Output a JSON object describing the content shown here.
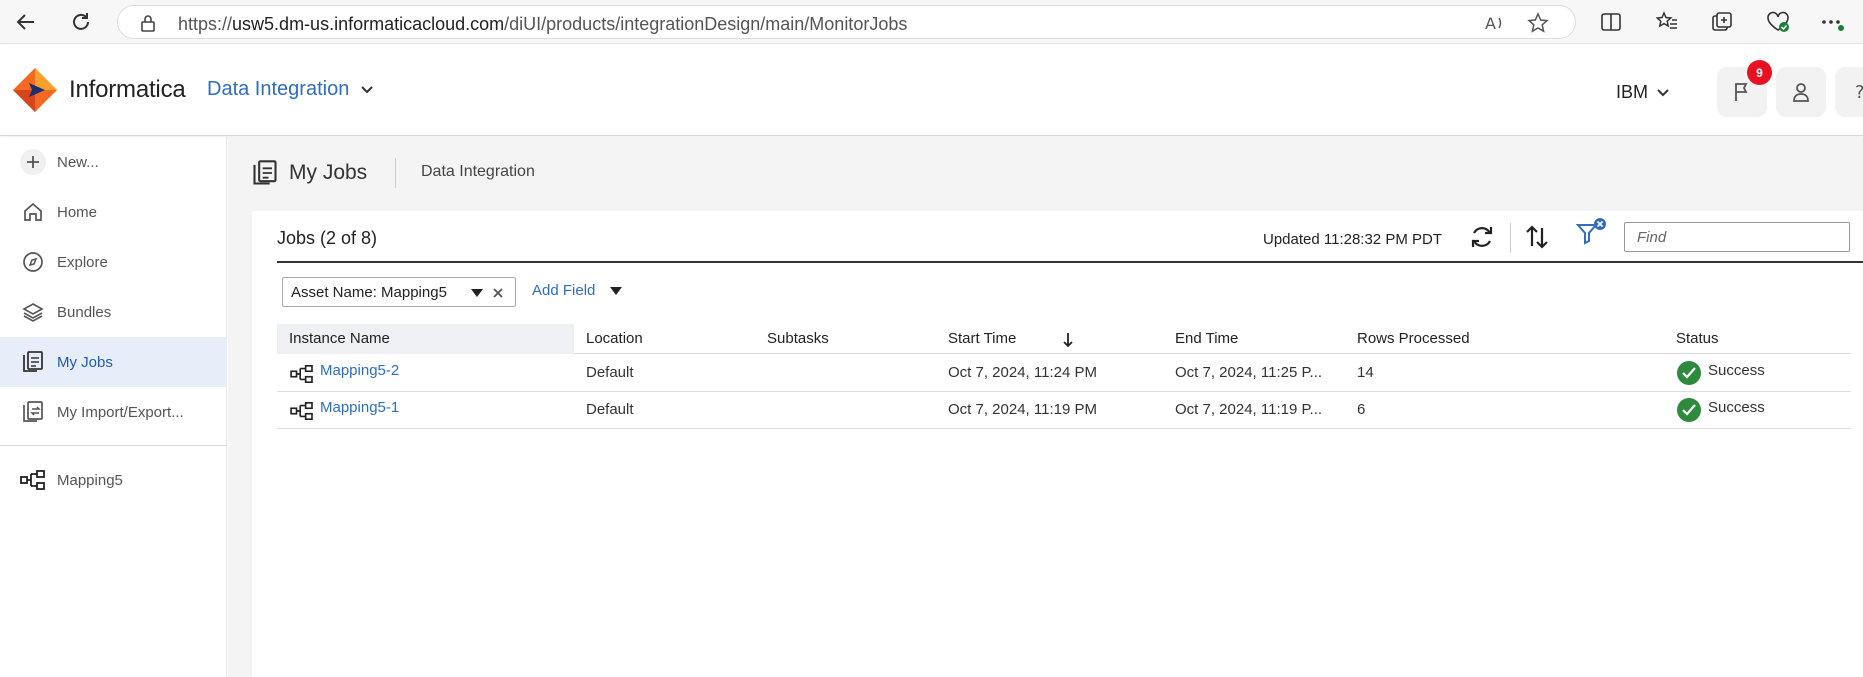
{
  "browser": {
    "url_prefix": "https://",
    "url_domain": "usw5.dm-us.informaticacloud.com",
    "url_path": "/diUI/products/integrationDesign/main/MonitorJobs"
  },
  "header": {
    "brand": "Informatica",
    "app_name": "Data Integration",
    "org": "IBM",
    "notification_count": "9"
  },
  "sidebar": {
    "items": [
      {
        "label": "New..."
      },
      {
        "label": "Home"
      },
      {
        "label": "Explore"
      },
      {
        "label": "Bundles"
      },
      {
        "label": "My Jobs"
      },
      {
        "label": "My Import/Export..."
      }
    ],
    "open_asset": "Mapping5"
  },
  "page": {
    "title": "My Jobs",
    "breadcrumb": "Data Integration"
  },
  "jobs": {
    "title": "Jobs (2 of 8)",
    "updated": "Updated 11:28:32 PM PDT",
    "find_placeholder": "Find",
    "filter_chip": "Asset Name: Mapping5",
    "add_field": "Add Field",
    "columns": [
      "Instance Name",
      "Location",
      "Subtasks",
      "Start Time",
      "End Time",
      "Rows Processed",
      "Status"
    ],
    "rows": [
      {
        "instance": "Mapping5-2",
        "location": "Default",
        "subtasks": "",
        "start": "Oct 7, 2024, 11:24 PM",
        "end": "Oct 7, 2024, 11:25 P...",
        "rows": "14",
        "status": "Success"
      },
      {
        "instance": "Mapping5-1",
        "location": "Default",
        "subtasks": "",
        "start": "Oct 7, 2024, 11:19 PM",
        "end": "Oct 7, 2024, 11:19 P...",
        "rows": "6",
        "status": "Success"
      }
    ]
  },
  "colors": {
    "link": "#2f6dc0",
    "success": "#2e8b3d",
    "badge": "#e81123",
    "brand_orange": "#f26a21"
  }
}
